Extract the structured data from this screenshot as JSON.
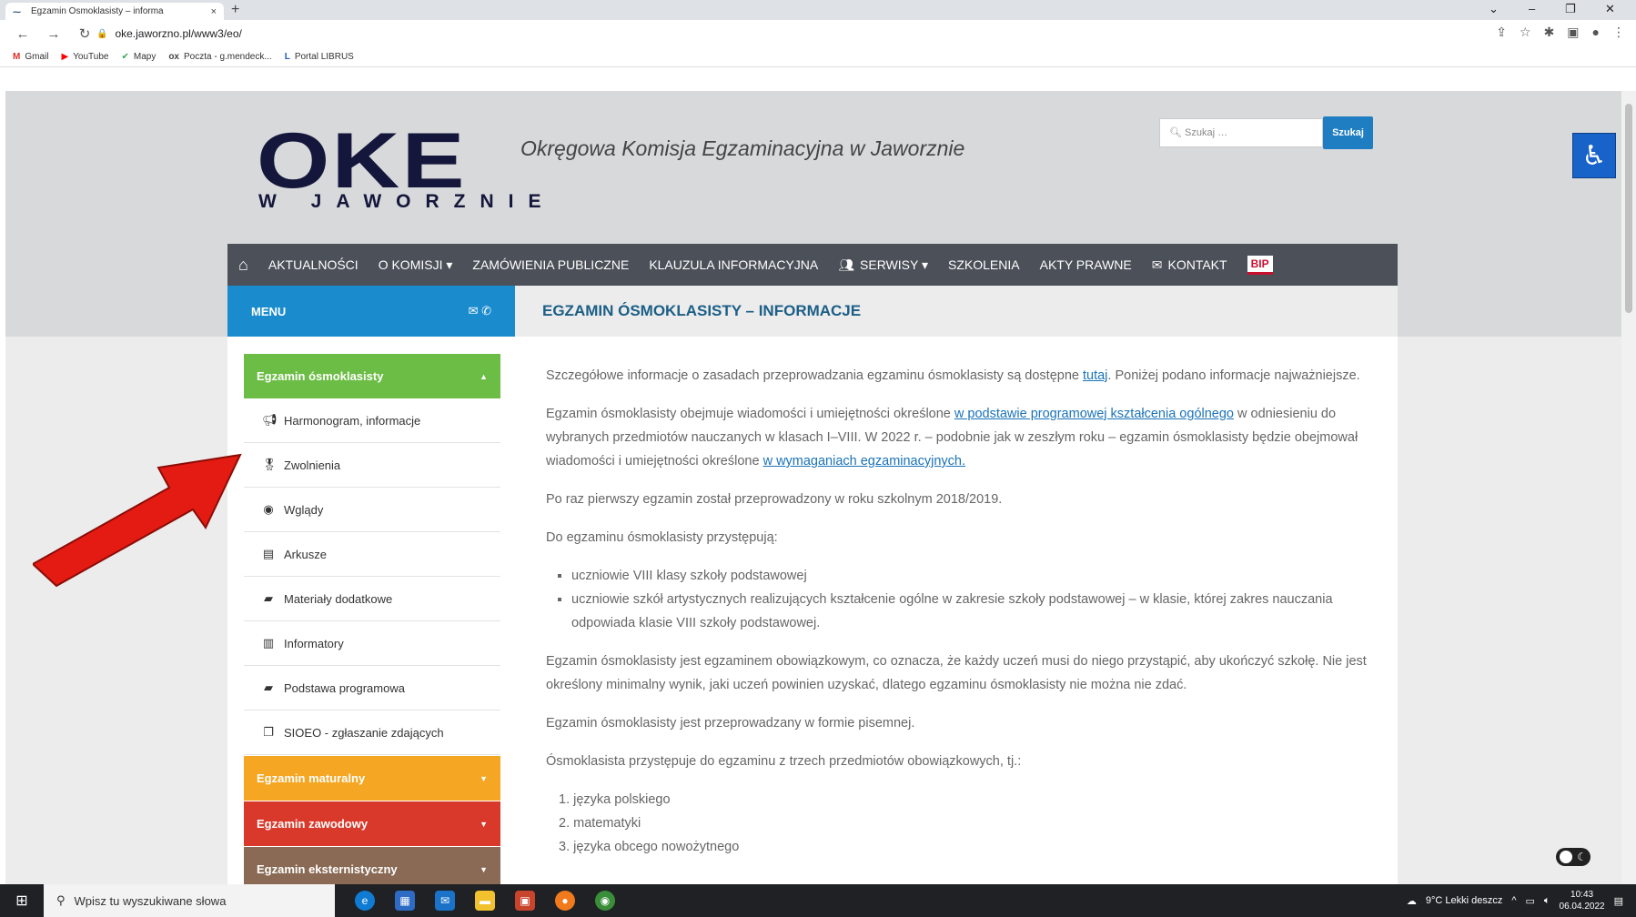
{
  "browser": {
    "tab_title": "Egzamin Ósmoklasisty – informa",
    "tab_close": "×",
    "new_tab": "+",
    "url": "oke.jaworzno.pl/www3/eo/",
    "bookmarks": [
      {
        "icon": "M",
        "label": "Gmail"
      },
      {
        "icon": "▶",
        "label": "YouTube"
      },
      {
        "icon": "✔",
        "label": "Mapy"
      },
      {
        "icon": "ox",
        "label": "Poczta - g.mendeck..."
      },
      {
        "icon": "L",
        "label": "Portal LIBRUS"
      }
    ]
  },
  "header": {
    "logo_big": "OKE",
    "logo_small": "W JAWORZNIE",
    "site_title": "Okręgowa Komisja Egzaminacyjna w Jaworznie",
    "search_placeholder": "Szukaj …",
    "search_button": "Szukaj"
  },
  "nav": {
    "items": [
      "AKTUALNOŚCI",
      "O KOMISJI ▾",
      "ZAMÓWIENIA PUBLICZNE",
      "KLAUZULA INFORMACYJNA",
      "SERWISY ▾",
      "SZKOLENIA",
      "AKTY PRAWNE",
      "KONTAKT"
    ],
    "bip": "BIP"
  },
  "sidebar": {
    "menu_label": "MENU",
    "active_section": "Egzamin ósmoklasisty",
    "active_color": "#6cbd45",
    "items": [
      {
        "icon": "megaphone-icon",
        "label": "Harmonogram, informacje"
      },
      {
        "icon": "medal-icon",
        "label": "Zwolnienia"
      },
      {
        "icon": "eye-icon",
        "label": "Wglądy"
      },
      {
        "icon": "document-icon",
        "label": "Arkusze"
      },
      {
        "icon": "book-icon",
        "label": "Materiały dodatkowe"
      },
      {
        "icon": "open-book-icon",
        "label": "Informatory"
      },
      {
        "icon": "book-icon",
        "label": "Podstawa programowa"
      },
      {
        "icon": "copy-icon",
        "label": "SIOEO - zgłaszanie zdających"
      }
    ],
    "sections": [
      {
        "label": "Egzamin maturalny",
        "color": "#f5a623"
      },
      {
        "label": "Egzamin zawodowy",
        "color": "#d9392b"
      },
      {
        "label": "Egzamin eksternistyczny",
        "color": "#8a6a55"
      }
    ]
  },
  "article": {
    "heading": "EGZAMIN ÓSMOKLASISTY – INFORMACJE",
    "p1_a": "Szczegółowe informacje o zasadach przeprowadzania egzaminu ósmoklasisty są dostępne ",
    "p1_link": "tutaj",
    "p1_b": ". Poniżej podano informacje najważniejsze.",
    "p2_a": "Egzamin ósmoklasisty obejmuje wiadomości i umiejętności określone ",
    "p2_link1": "w podstawie programowej kształcenia ogólnego",
    "p2_b": " w odniesieniu do wybranych przedmiotów nauczanych w klasach I–VIII. W 2022 r. – podobnie jak w zeszłym roku – egzamin ósmoklasisty będzie obejmował wiadomości i umiejętności określone ",
    "p2_link2": "w wymaganiach egzaminacyjnych.",
    "p3": "Po raz pierwszy egzamin został przeprowadzony w roku szkolnym 2018/2019.",
    "p4": "Do egzaminu ósmoklasisty przystępują:",
    "list": [
      "uczniowie VIII klasy szkoły podstawowej",
      "uczniowie szkół artystycznych realizujących kształcenie ogólne w zakresie szkoły podstawowej – w klasie, której zakres nauczania odpowiada klasie VIII szkoły podstawowej."
    ],
    "p5": "Egzamin ósmoklasisty jest egzaminem obowiązkowym, co oznacza, że każdy uczeń musi do niego przystąpić, aby ukończyć szkołę. Nie jest określony minimalny wynik, jaki uczeń powinien uzyskać, dlatego egzaminu ósmoklasisty nie można nie zdać.",
    "p6": "Egzamin ósmoklasisty jest przeprowadzany w formie pisemnej.",
    "p7": "Ósmoklasista przystępuje do egzaminu z trzech przedmiotów obowiązkowych, tj.:",
    "subjects": [
      "1. języka polskiego",
      "2. matematyki",
      "3. języka obcego nowożytnego"
    ]
  },
  "taskbar": {
    "search_placeholder": "Wpisz tu wyszukiwane słowa",
    "weather": "9°C  Lekki deszcz",
    "time": "10:43",
    "date": "06.04.2022"
  }
}
